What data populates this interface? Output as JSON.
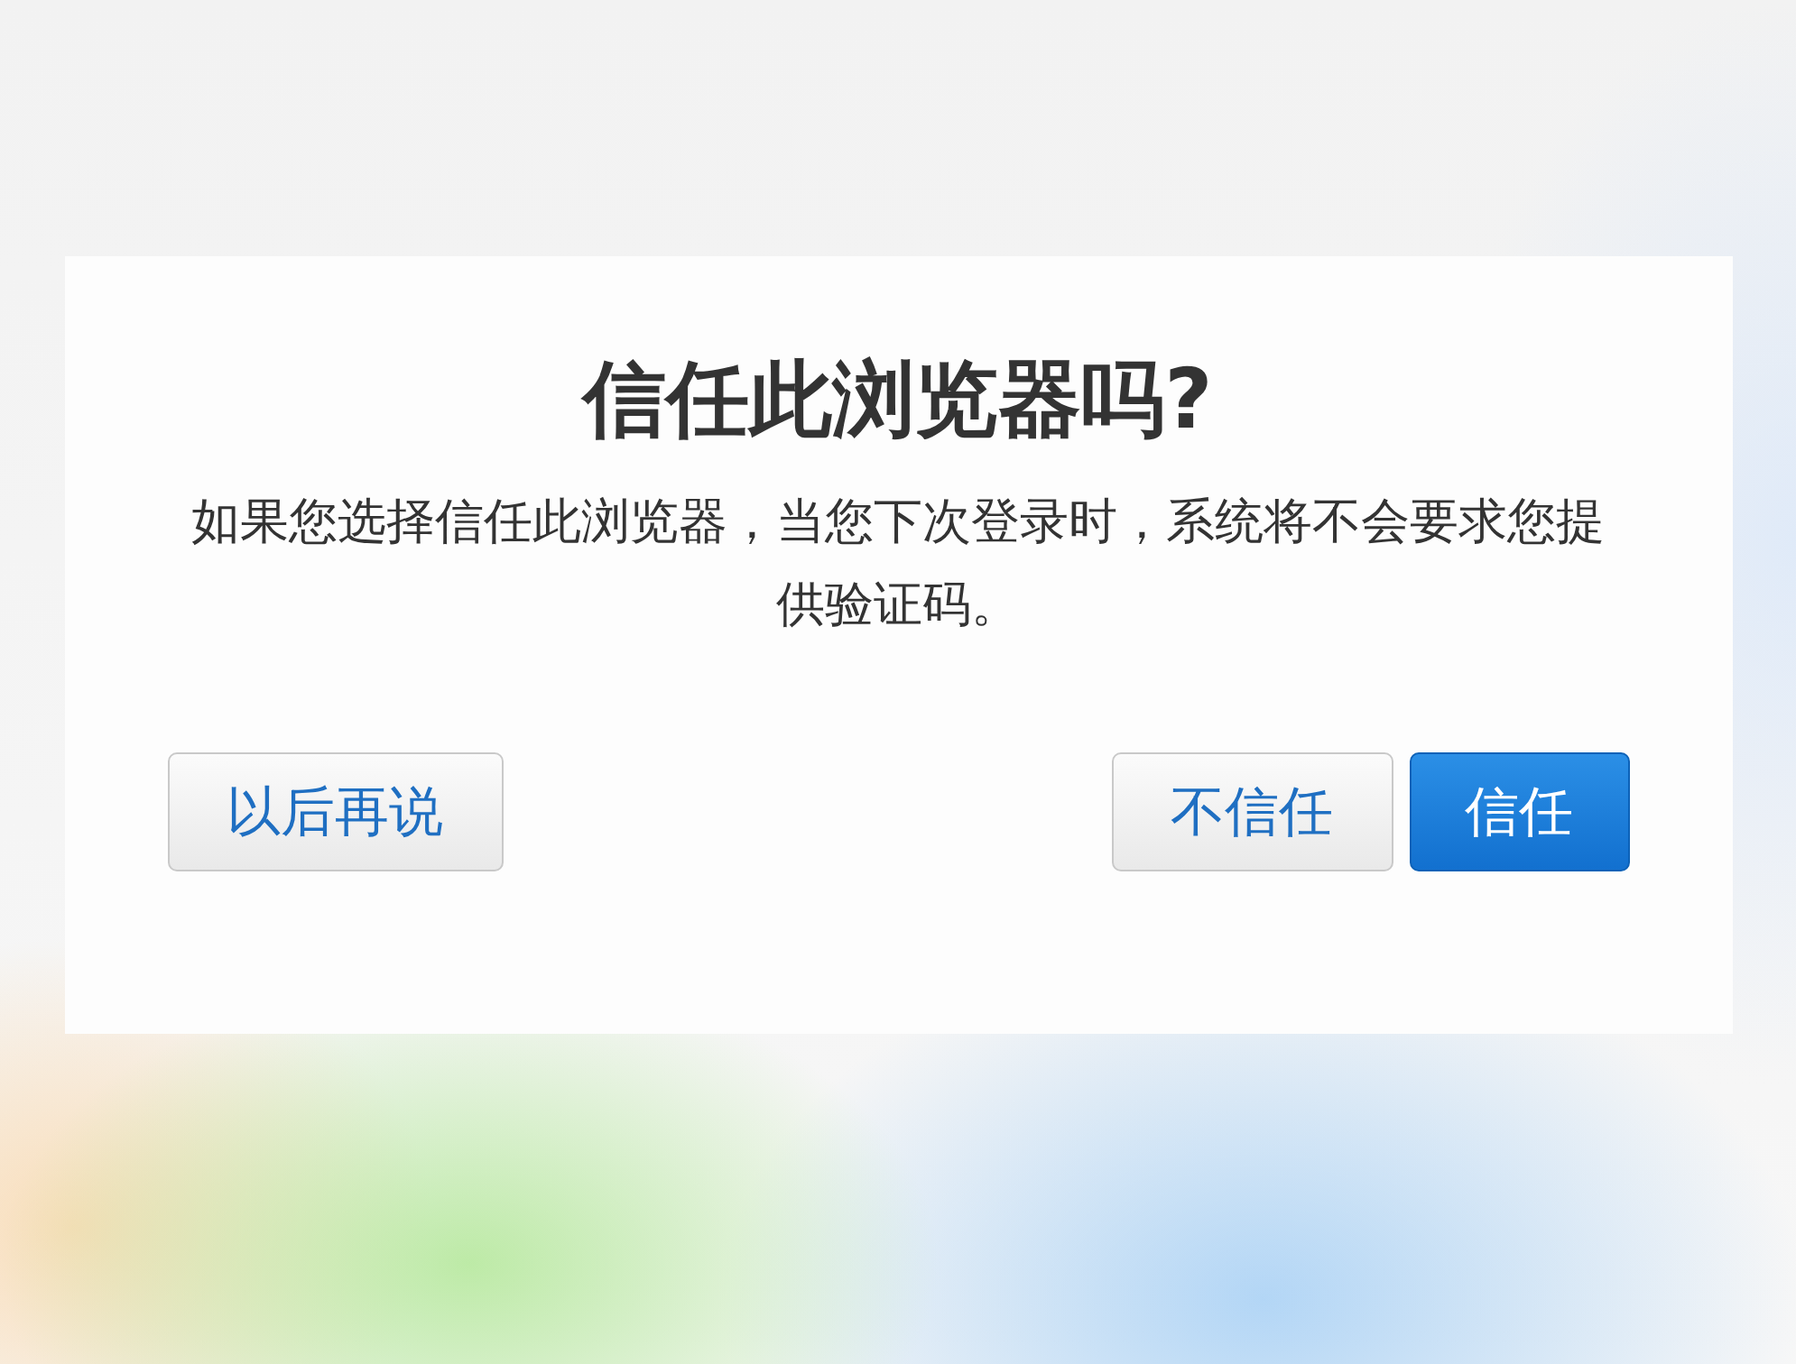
{
  "dialog": {
    "title": "信任此浏览器吗?",
    "message": "如果您选择信任此浏览器，当您下次登录时，系统将不会要求您提供验证码。",
    "buttons": [
      {
        "label": "以后再说",
        "kind": "secondary"
      },
      {
        "label": "不信任",
        "kind": "secondary"
      },
      {
        "label": "信任",
        "kind": "primary"
      }
    ]
  }
}
